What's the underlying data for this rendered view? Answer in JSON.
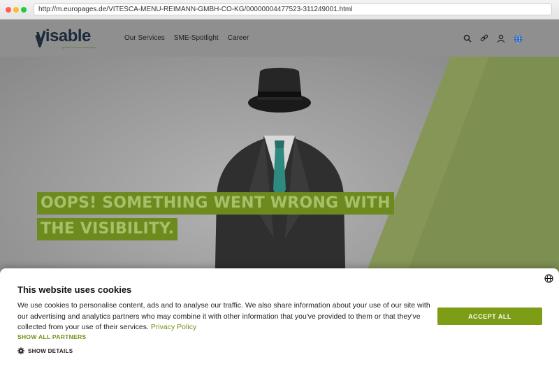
{
  "browser": {
    "url": "http://m.europages.de/VITESCA-MENU-REIMANN-GMBH-CO-KG/00000004477523-311249001.html"
  },
  "header": {
    "logo_text": "visable",
    "logo_tagline": "global business made easy",
    "nav": [
      {
        "label": "Our Services"
      },
      {
        "label": "SME-Spotlight"
      },
      {
        "label": "Career"
      }
    ],
    "icons": [
      "search-icon",
      "link-icon",
      "user-icon",
      "globe-icon"
    ]
  },
  "hero": {
    "headline_lines": [
      "OOPS! SOMETHING WENT WRONG WITH",
      "THE VISIBILITY."
    ]
  },
  "cookie": {
    "title": "This website uses cookies",
    "body": "We use cookies to personalise content, ads and to analyse our traffic. We also share information about your use of our site with our advertising and analytics partners who may combine it with other information that you've provided to them or that they've collected from your use of their services.",
    "privacy_link": "Privacy Policy",
    "show_partners": "SHOW ALL PARTNERS",
    "show_details": "SHOW DETAILS",
    "accept_label": "ACCEPT ALL"
  },
  "colors": {
    "accent": "#7d9d16",
    "headline_bg": "#6c8a1e",
    "headline_text": "#a8c06a",
    "logo_dark": "#1c2a3a"
  }
}
